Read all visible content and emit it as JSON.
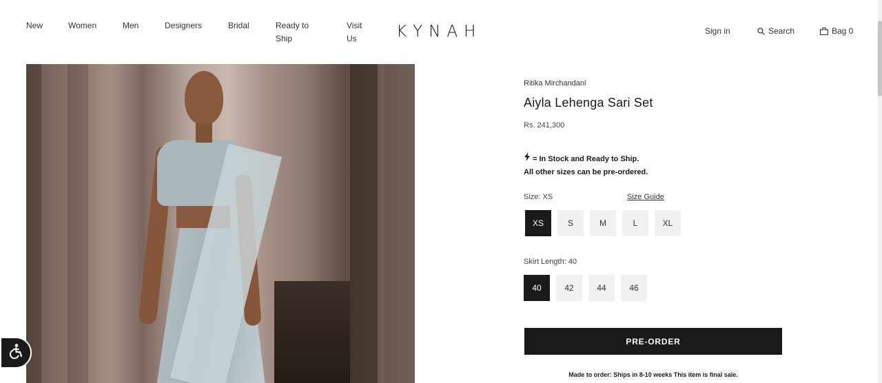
{
  "header": {
    "nav": [
      "New",
      "Women",
      "Men",
      "Designers",
      "Bridal",
      "Ready to Ship",
      "Visit Us"
    ],
    "logo": "KYNAH",
    "sign_in": "Sign in",
    "search": "Search",
    "bag": "Bag 0"
  },
  "product": {
    "designer": "Ritika Mirchandani",
    "title": "Aiyla Lehenga Sari Set",
    "price": "Rs. 241,300",
    "stock_line1": "= In Stock and Ready to Ship.",
    "stock_line2": "All other sizes can be pre-ordered.",
    "size_label": "Size: XS",
    "size_guide": "Size Guide",
    "sizes": [
      "XS",
      "S",
      "M",
      "L",
      "XL"
    ],
    "selected_size": "XS",
    "skirt_label": "Skirt Length: 40",
    "lengths": [
      "40",
      "42",
      "44",
      "46"
    ],
    "selected_length": "40",
    "preorder_label": "PRE-ORDER",
    "made_note": "Made to order: Ships in 8-10 weeks This item is final sale."
  },
  "icons": {
    "search": "search-icon",
    "bag": "bag-icon",
    "bolt": "lightning-icon",
    "accessibility": "accessibility-icon"
  }
}
